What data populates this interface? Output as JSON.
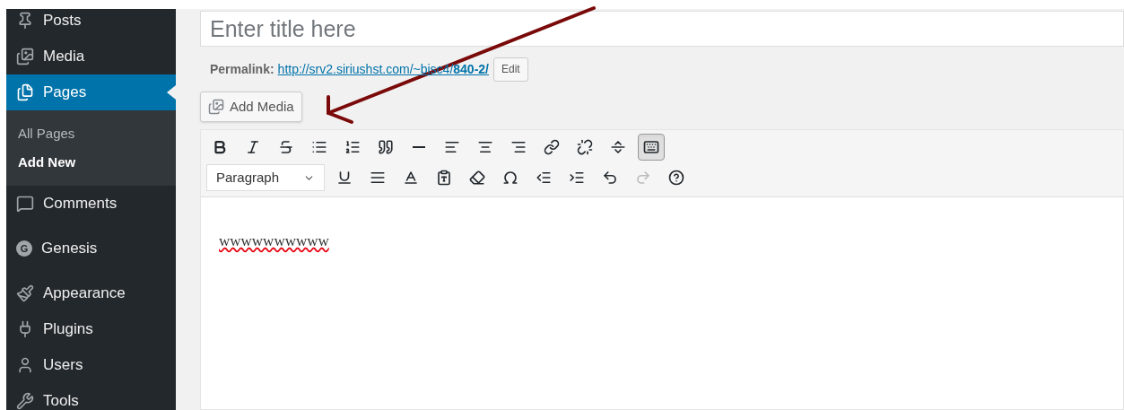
{
  "sidebar": {
    "groups": [
      [
        {
          "label": "Posts",
          "kind": "pin",
          "current": false
        },
        {
          "label": "Media",
          "kind": "media",
          "current": false
        },
        {
          "label": "Pages",
          "kind": "pages",
          "current": true,
          "submenu": [
            {
              "label": "All Pages",
              "selected": false
            },
            {
              "label": "Add New",
              "selected": true
            }
          ]
        }
      ],
      [
        {
          "label": "Comments",
          "kind": "comments",
          "current": false
        }
      ],
      [
        {
          "label": "Genesis",
          "kind": "letter",
          "icon_text": "G",
          "current": false
        }
      ],
      [
        {
          "label": "Appearance",
          "kind": "brush",
          "current": false
        },
        {
          "label": "Plugins",
          "kind": "plug",
          "current": false
        },
        {
          "label": "Users",
          "kind": "user",
          "current": false
        },
        {
          "label": "Tools",
          "kind": "wrench",
          "current": false
        }
      ]
    ]
  },
  "title_field": {
    "placeholder": "Enter title here"
  },
  "permalink": {
    "label": "Permalink:",
    "url_prefix": "http://srv2.siriushst.com/~bisc4/",
    "url_slug": "840-2/",
    "button": "Edit"
  },
  "add_media_button": "Add Media",
  "toolbar": {
    "rows": [
      [
        {
          "kind": "bold",
          "pressed": false,
          "disabled": false
        },
        {
          "kind": "italic",
          "pressed": false,
          "disabled": false
        },
        {
          "kind": "strike",
          "pressed": false,
          "disabled": false
        },
        {
          "kind": "bullets",
          "pressed": false,
          "disabled": false
        },
        {
          "kind": "numbers",
          "pressed": false,
          "disabled": false
        },
        {
          "kind": "quote",
          "pressed": false,
          "disabled": false
        },
        {
          "kind": "rule",
          "pressed": false,
          "disabled": false
        },
        {
          "kind": "align-left",
          "pressed": false,
          "disabled": false
        },
        {
          "kind": "align-center",
          "pressed": false,
          "disabled": false
        },
        {
          "kind": "align-right",
          "pressed": false,
          "disabled": false
        },
        {
          "kind": "link",
          "pressed": false,
          "disabled": false
        },
        {
          "kind": "unlink",
          "pressed": false,
          "disabled": false
        },
        {
          "kind": "more",
          "pressed": false,
          "disabled": false
        },
        {
          "kind": "kitchen-sink",
          "pressed": true,
          "disabled": false
        }
      ],
      [
        {
          "kind": "format",
          "value": "Paragraph"
        },
        {
          "kind": "underline",
          "pressed": false,
          "disabled": false
        },
        {
          "kind": "justify",
          "pressed": false,
          "disabled": false
        },
        {
          "kind": "text-color",
          "pressed": false,
          "disabled": false
        },
        {
          "kind": "paste-text",
          "pressed": false,
          "disabled": false
        },
        {
          "kind": "clear",
          "pressed": false,
          "disabled": false
        },
        {
          "kind": "omega",
          "pressed": false,
          "disabled": false
        },
        {
          "kind": "outdent",
          "pressed": false,
          "disabled": false
        },
        {
          "kind": "indent",
          "pressed": false,
          "disabled": false
        },
        {
          "kind": "undo",
          "pressed": false,
          "disabled": false
        },
        {
          "kind": "redo",
          "pressed": false,
          "disabled": true
        },
        {
          "kind": "help",
          "pressed": false,
          "disabled": false
        }
      ]
    ]
  },
  "editor": {
    "content": "wwwwwwwwww",
    "misspelled": true
  }
}
